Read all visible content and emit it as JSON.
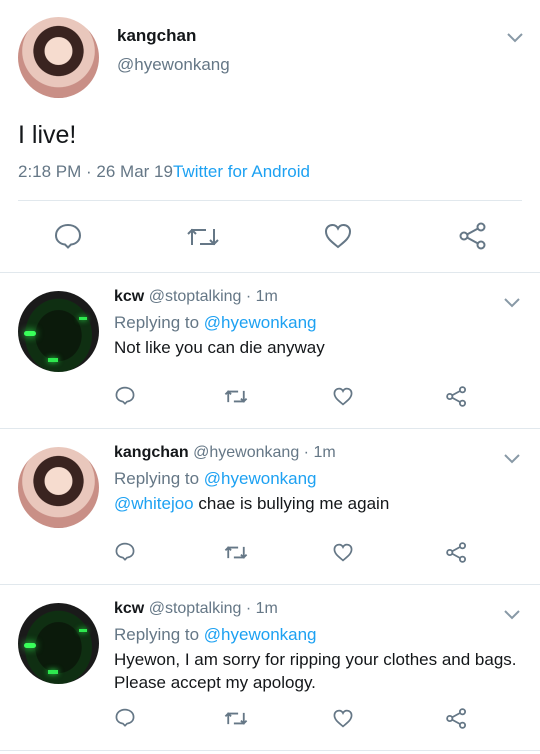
{
  "main_tweet": {
    "display_name": "kangchan",
    "handle": "@hyewonkang",
    "text": "I live!",
    "time": "2:18 PM · 26 Mar 19",
    "client": "Twitter for Android"
  },
  "replying_to_prefix": "Replying to",
  "replies": [
    {
      "display_name": "kcw",
      "handle": "@stoptalking",
      "time": "1m",
      "replying_to": "@hyewonkang",
      "text_lines": [
        "Not like you can die anyway"
      ]
    },
    {
      "display_name": "kangchan",
      "handle": "@hyewonkang",
      "time": "1m",
      "replying_to": "@hyewonkang",
      "mention": "@whitejoo",
      "text": "chae is bullying me again"
    },
    {
      "display_name": "kcw",
      "handle": "@stoptalking",
      "time": "1m",
      "replying_to": "@hyewonkang",
      "text_lines": [
        "Hyewon, I am sorry for ripping your clothes and bags.",
        "Please accept my apology."
      ]
    }
  ],
  "icons": [
    "reply-icon",
    "retweet-icon",
    "like-icon",
    "share-icon",
    "chevron-down-icon"
  ],
  "colors": {
    "accent": "#1da1f2",
    "text": "#14171a",
    "secondary": "#657786",
    "divider": "#e1e8ed"
  }
}
